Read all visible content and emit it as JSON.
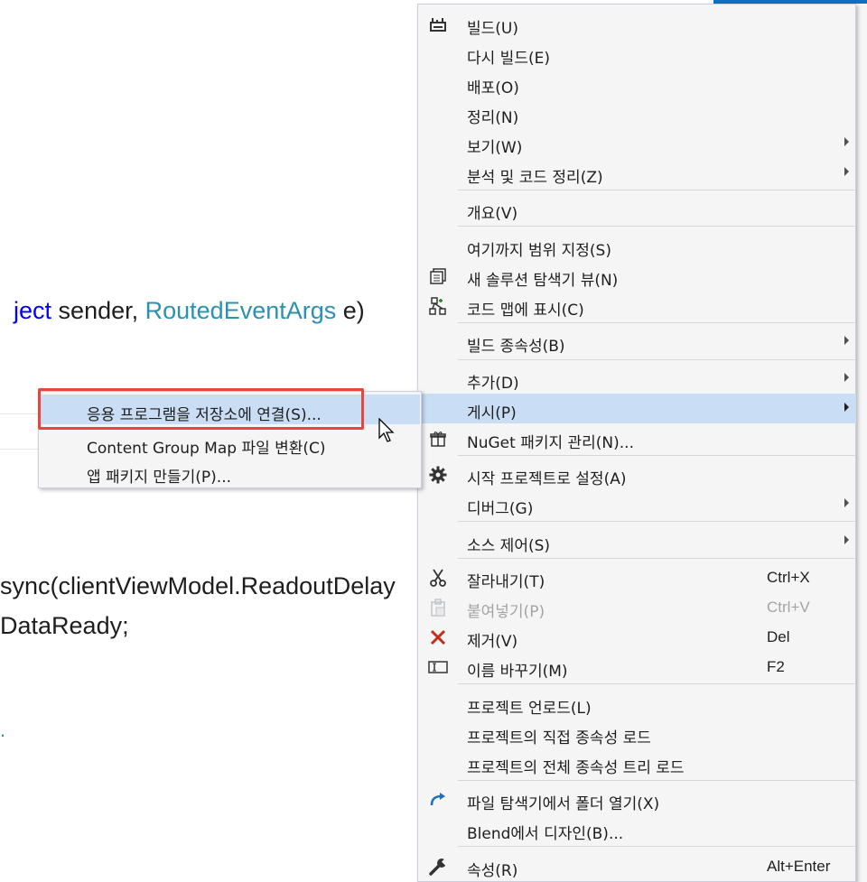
{
  "editor": {
    "line1": {
      "kw": "ject",
      "rest1": " sender, ",
      "type": "RoutedEventArgs",
      "rest2": " e)"
    },
    "line2": "sync(clientViewModel.ReadoutDelay",
    "line3": "DataReady;",
    "mark": "."
  },
  "context_menu": {
    "items": [
      {
        "label": "빌드(U)",
        "icon": "build-icon"
      },
      {
        "label": "다시 빌드(E)"
      },
      {
        "label": "배포(O)"
      },
      {
        "label": "정리(N)"
      },
      {
        "label": "보기(W)",
        "submenu": true
      },
      {
        "label": "분석 및 코드 정리(Z)",
        "submenu": true
      },
      {
        "label": "개요(V)"
      },
      {
        "label": "여기까지 범위 지정(S)"
      },
      {
        "label": "새 솔루션 탐색기 뷰(N)",
        "icon": "new-solution-view-icon"
      },
      {
        "label": "코드 맵에 표시(C)",
        "icon": "code-map-icon"
      },
      {
        "label": "빌드 종속성(B)",
        "submenu": true
      },
      {
        "label": "추가(D)",
        "submenu": true
      },
      {
        "label": "게시(P)",
        "submenu": true,
        "highlighted": true
      },
      {
        "label": "NuGet 패키지 관리(N)...",
        "icon": "nuget-package-icon"
      },
      {
        "label": "시작 프로젝트로 설정(A)",
        "icon": "gear-icon"
      },
      {
        "label": "디버그(G)",
        "submenu": true
      },
      {
        "label": "소스 제어(S)",
        "submenu": true
      },
      {
        "label": "잘라내기(T)",
        "shortcut": "Ctrl+X",
        "icon": "scissors-icon"
      },
      {
        "label": "붙여넣기(P)",
        "shortcut": "Ctrl+V",
        "icon": "paste-icon",
        "disabled": true
      },
      {
        "label": "제거(V)",
        "shortcut": "Del",
        "icon": "delete-x-icon"
      },
      {
        "label": "이름 바꾸기(M)",
        "shortcut": "F2",
        "icon": "rename-icon"
      },
      {
        "label": "프로젝트 언로드(L)"
      },
      {
        "label": "프로젝트의 직접 종속성 로드"
      },
      {
        "label": "프로젝트의 전체 종속성 트리 로드"
      },
      {
        "label": "파일 탐색기에서 폴더 열기(X)",
        "icon": "open-folder-arrow-icon"
      },
      {
        "label": "Blend에서 디자인(B)..."
      },
      {
        "label": "속성(R)",
        "shortcut": "Alt+Enter",
        "icon": "wrench-icon"
      }
    ]
  },
  "submenu": {
    "items": [
      {
        "label": "응용 프로그램을 저장소에 연결(S)...",
        "highlighted": true
      },
      {
        "label": "Content Group Map 파일 변환(C)"
      },
      {
        "label": "앱 패키지 만들기(P)..."
      }
    ]
  },
  "colors": {
    "highlight": "#c9def5",
    "menu_bg": "#f5f5f5",
    "callout_red": "#e8453c",
    "keyword_blue": "#0000ff",
    "type_teal": "#2b91af",
    "delete_red": "#c42b1c"
  }
}
